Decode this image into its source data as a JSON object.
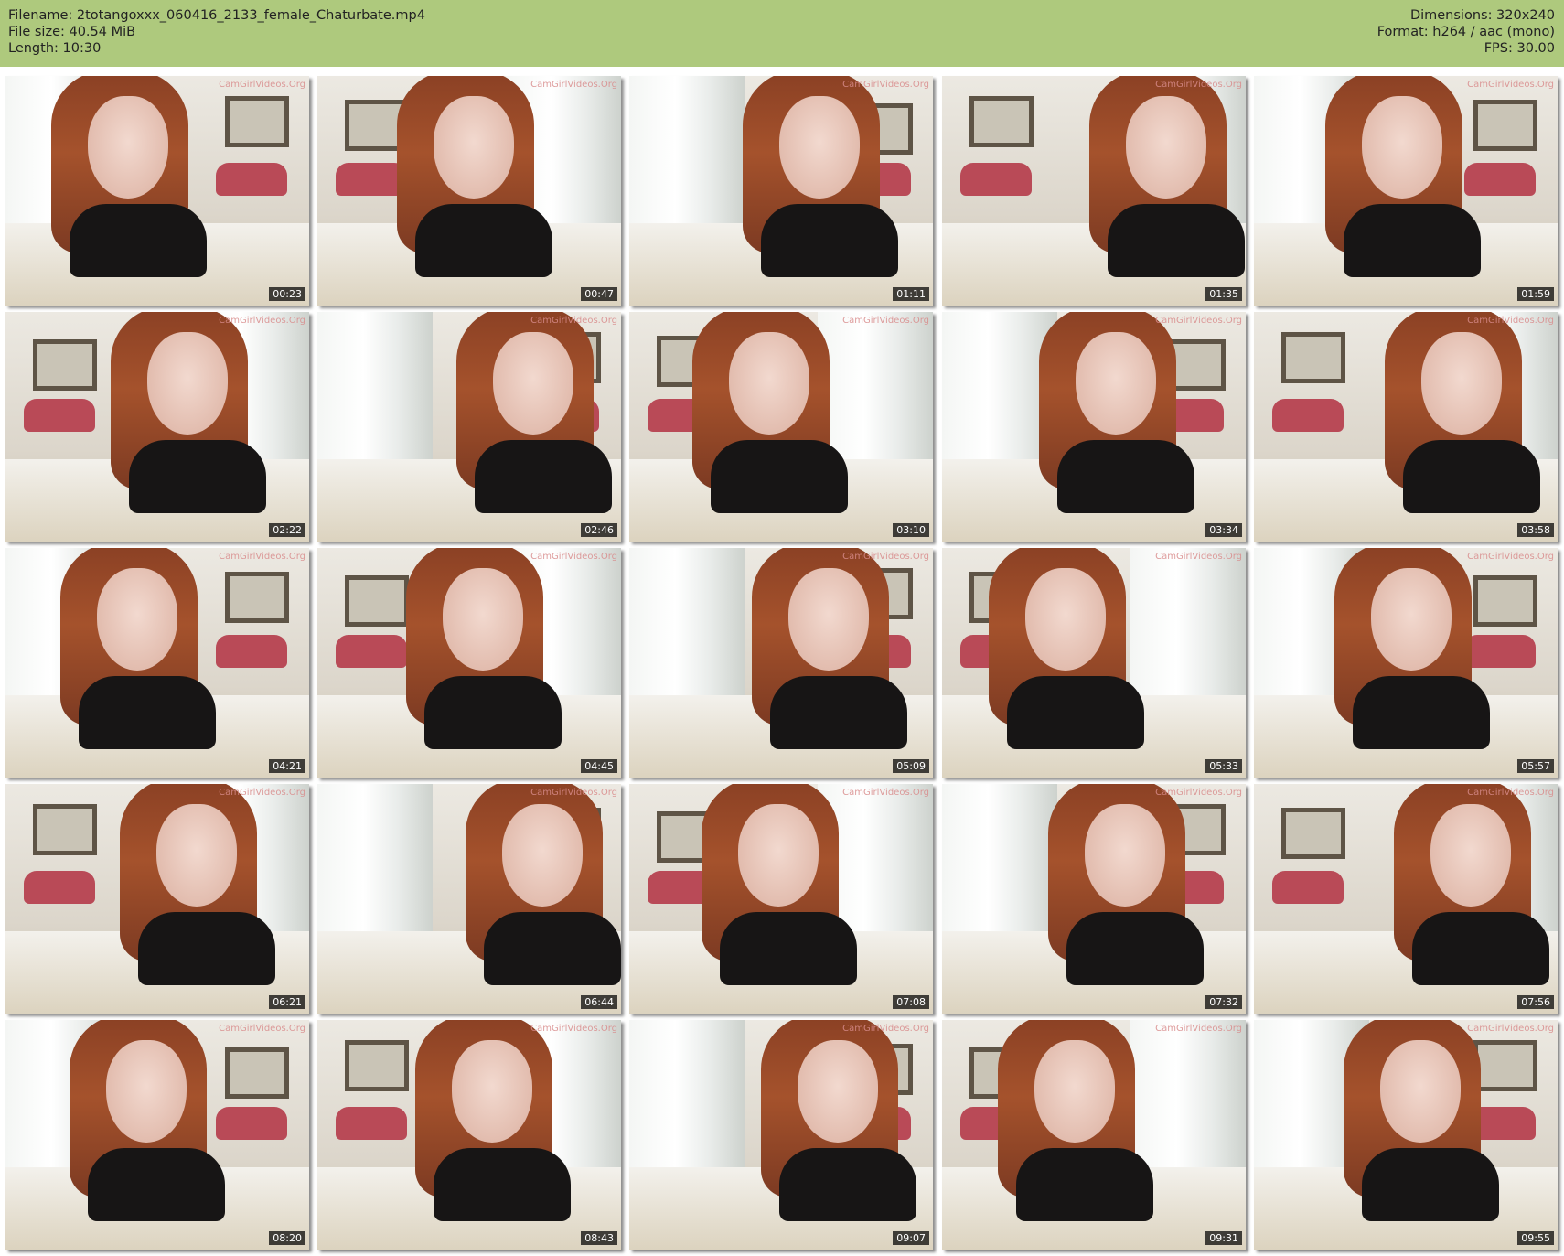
{
  "header": {
    "filename": "Filename: 2totangoxxx_060416_2133_female_Chaturbate.mp4",
    "file_size": "File size: 40.54 MiB",
    "length": "Length: 10:30",
    "dimensions": "Dimensions: 320x240",
    "format": "Format: h264 / aac (mono)",
    "fps": "FPS: 30.00"
  },
  "thumbnails": [
    {
      "timestamp": "00:23",
      "watermark": "CamGirlVideos.Org"
    },
    {
      "timestamp": "00:47",
      "watermark": "CamGirlVideos.Org"
    },
    {
      "timestamp": "01:11",
      "watermark": "CamGirlVideos.Org"
    },
    {
      "timestamp": "01:35",
      "watermark": "CamGirlVideos.Org"
    },
    {
      "timestamp": "01:59",
      "watermark": "CamGirlVideos.Org"
    },
    {
      "timestamp": "02:22",
      "watermark": "CamGirlVideos.Org"
    },
    {
      "timestamp": "02:46",
      "watermark": "CamGirlVideos.Org"
    },
    {
      "timestamp": "03:10",
      "watermark": "CamGirlVideos.Org"
    },
    {
      "timestamp": "03:34",
      "watermark": "CamGirlVideos.Org"
    },
    {
      "timestamp": "03:58",
      "watermark": "CamGirlVideos.Org"
    },
    {
      "timestamp": "04:21",
      "watermark": "CamGirlVideos.Org"
    },
    {
      "timestamp": "04:45",
      "watermark": "CamGirlVideos.Org"
    },
    {
      "timestamp": "05:09",
      "watermark": "CamGirlVideos.Org"
    },
    {
      "timestamp": "05:33",
      "watermark": "CamGirlVideos.Org"
    },
    {
      "timestamp": "05:57",
      "watermark": "CamGirlVideos.Org"
    },
    {
      "timestamp": "06:21",
      "watermark": "CamGirlVideos.Org"
    },
    {
      "timestamp": "06:44",
      "watermark": "CamGirlVideos.Org"
    },
    {
      "timestamp": "07:08",
      "watermark": "CamGirlVideos.Org"
    },
    {
      "timestamp": "07:32",
      "watermark": "CamGirlVideos.Org"
    },
    {
      "timestamp": "07:56",
      "watermark": "CamGirlVideos.Org"
    },
    {
      "timestamp": "08:20",
      "watermark": "CamGirlVideos.Org"
    },
    {
      "timestamp": "08:43",
      "watermark": "CamGirlVideos.Org"
    },
    {
      "timestamp": "09:07",
      "watermark": "CamGirlVideos.Org"
    },
    {
      "timestamp": "09:31",
      "watermark": "CamGirlVideos.Org"
    },
    {
      "timestamp": "09:55",
      "watermark": "CamGirlVideos.Org"
    }
  ],
  "colors": {
    "header_background": "#aec97d",
    "header_text": "#222222",
    "timestamp_background": "#000000",
    "timestamp_text": "#ffffff"
  }
}
